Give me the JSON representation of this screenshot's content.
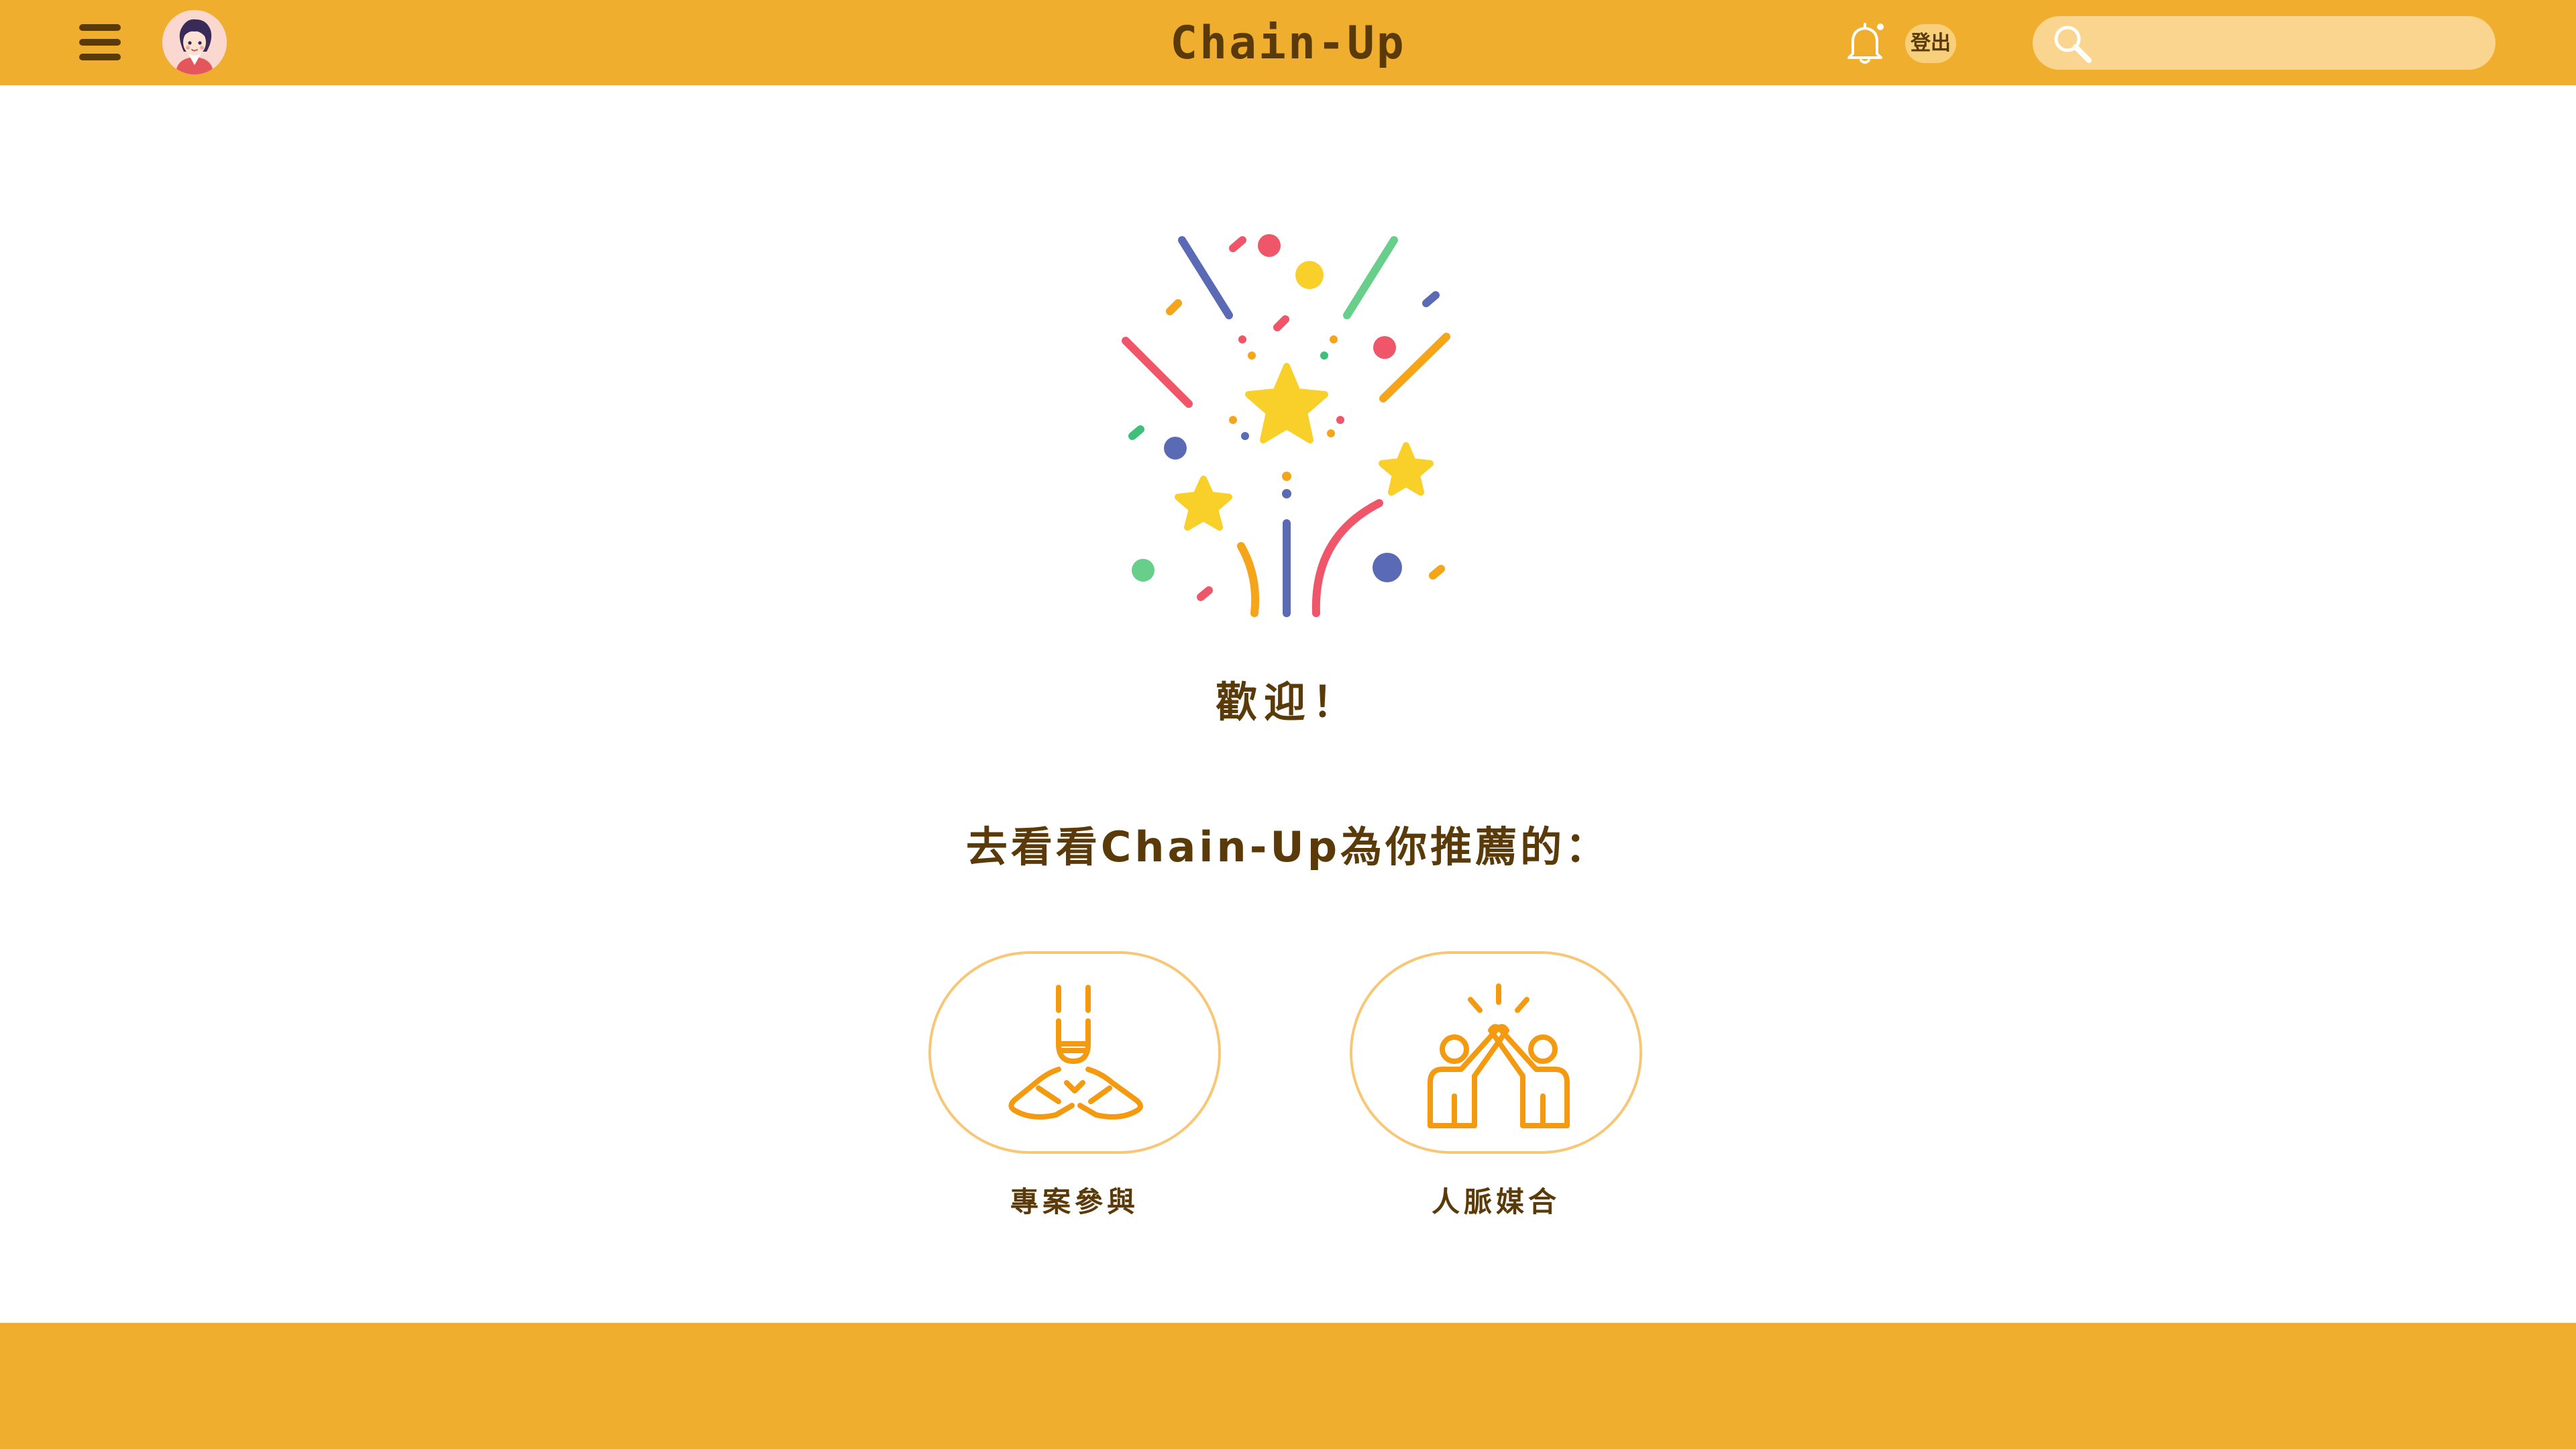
{
  "header": {
    "app_title": "Chain-Up",
    "logout_label": "登出",
    "search": {
      "placeholder": "",
      "value": ""
    },
    "icons": [
      "menu-icon",
      "avatar",
      "bell-icon",
      "search-icon"
    ]
  },
  "main": {
    "welcome": "歡迎！",
    "subtitle": "去看看Chain-Up為你推薦的：",
    "cards": [
      {
        "label": "專案參與",
        "icon": "hands-together-icon"
      },
      {
        "label": "人脈媒合",
        "icon": "high-five-icon"
      }
    ]
  },
  "colors": {
    "header_bg": "#f0ae2e",
    "text_brown": "#5a3a08",
    "icon_orange": "#f39a11",
    "card_border": "#f7c776",
    "search_bg": "#fad58f"
  }
}
